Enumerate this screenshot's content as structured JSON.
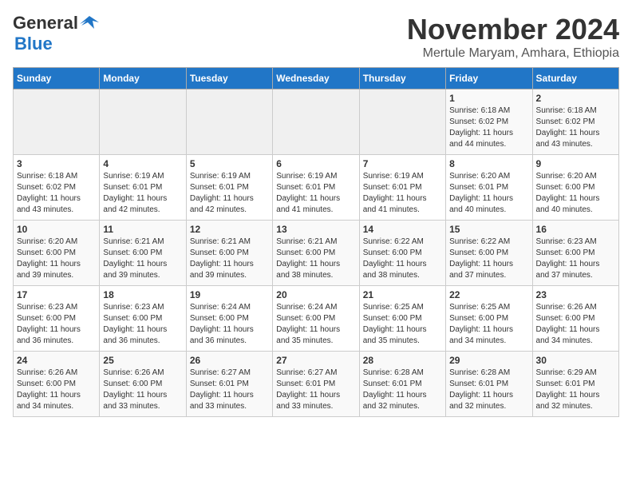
{
  "header": {
    "logo_line1": "General",
    "logo_line2": "Blue",
    "month_title": "November 2024",
    "subtitle": "Mertule Maryam, Amhara, Ethiopia"
  },
  "days_of_week": [
    "Sunday",
    "Monday",
    "Tuesday",
    "Wednesday",
    "Thursday",
    "Friday",
    "Saturday"
  ],
  "weeks": [
    [
      {
        "day": "",
        "info": ""
      },
      {
        "day": "",
        "info": ""
      },
      {
        "day": "",
        "info": ""
      },
      {
        "day": "",
        "info": ""
      },
      {
        "day": "",
        "info": ""
      },
      {
        "day": "1",
        "info": "Sunrise: 6:18 AM\nSunset: 6:02 PM\nDaylight: 11 hours\nand 44 minutes."
      },
      {
        "day": "2",
        "info": "Sunrise: 6:18 AM\nSunset: 6:02 PM\nDaylight: 11 hours\nand 43 minutes."
      }
    ],
    [
      {
        "day": "3",
        "info": "Sunrise: 6:18 AM\nSunset: 6:02 PM\nDaylight: 11 hours\nand 43 minutes."
      },
      {
        "day": "4",
        "info": "Sunrise: 6:19 AM\nSunset: 6:01 PM\nDaylight: 11 hours\nand 42 minutes."
      },
      {
        "day": "5",
        "info": "Sunrise: 6:19 AM\nSunset: 6:01 PM\nDaylight: 11 hours\nand 42 minutes."
      },
      {
        "day": "6",
        "info": "Sunrise: 6:19 AM\nSunset: 6:01 PM\nDaylight: 11 hours\nand 41 minutes."
      },
      {
        "day": "7",
        "info": "Sunrise: 6:19 AM\nSunset: 6:01 PM\nDaylight: 11 hours\nand 41 minutes."
      },
      {
        "day": "8",
        "info": "Sunrise: 6:20 AM\nSunset: 6:01 PM\nDaylight: 11 hours\nand 40 minutes."
      },
      {
        "day": "9",
        "info": "Sunrise: 6:20 AM\nSunset: 6:00 PM\nDaylight: 11 hours\nand 40 minutes."
      }
    ],
    [
      {
        "day": "10",
        "info": "Sunrise: 6:20 AM\nSunset: 6:00 PM\nDaylight: 11 hours\nand 39 minutes."
      },
      {
        "day": "11",
        "info": "Sunrise: 6:21 AM\nSunset: 6:00 PM\nDaylight: 11 hours\nand 39 minutes."
      },
      {
        "day": "12",
        "info": "Sunrise: 6:21 AM\nSunset: 6:00 PM\nDaylight: 11 hours\nand 39 minutes."
      },
      {
        "day": "13",
        "info": "Sunrise: 6:21 AM\nSunset: 6:00 PM\nDaylight: 11 hours\nand 38 minutes."
      },
      {
        "day": "14",
        "info": "Sunrise: 6:22 AM\nSunset: 6:00 PM\nDaylight: 11 hours\nand 38 minutes."
      },
      {
        "day": "15",
        "info": "Sunrise: 6:22 AM\nSunset: 6:00 PM\nDaylight: 11 hours\nand 37 minutes."
      },
      {
        "day": "16",
        "info": "Sunrise: 6:23 AM\nSunset: 6:00 PM\nDaylight: 11 hours\nand 37 minutes."
      }
    ],
    [
      {
        "day": "17",
        "info": "Sunrise: 6:23 AM\nSunset: 6:00 PM\nDaylight: 11 hours\nand 36 minutes."
      },
      {
        "day": "18",
        "info": "Sunrise: 6:23 AM\nSunset: 6:00 PM\nDaylight: 11 hours\nand 36 minutes."
      },
      {
        "day": "19",
        "info": "Sunrise: 6:24 AM\nSunset: 6:00 PM\nDaylight: 11 hours\nand 36 minutes."
      },
      {
        "day": "20",
        "info": "Sunrise: 6:24 AM\nSunset: 6:00 PM\nDaylight: 11 hours\nand 35 minutes."
      },
      {
        "day": "21",
        "info": "Sunrise: 6:25 AM\nSunset: 6:00 PM\nDaylight: 11 hours\nand 35 minutes."
      },
      {
        "day": "22",
        "info": "Sunrise: 6:25 AM\nSunset: 6:00 PM\nDaylight: 11 hours\nand 34 minutes."
      },
      {
        "day": "23",
        "info": "Sunrise: 6:26 AM\nSunset: 6:00 PM\nDaylight: 11 hours\nand 34 minutes."
      }
    ],
    [
      {
        "day": "24",
        "info": "Sunrise: 6:26 AM\nSunset: 6:00 PM\nDaylight: 11 hours\nand 34 minutes."
      },
      {
        "day": "25",
        "info": "Sunrise: 6:26 AM\nSunset: 6:00 PM\nDaylight: 11 hours\nand 33 minutes."
      },
      {
        "day": "26",
        "info": "Sunrise: 6:27 AM\nSunset: 6:01 PM\nDaylight: 11 hours\nand 33 minutes."
      },
      {
        "day": "27",
        "info": "Sunrise: 6:27 AM\nSunset: 6:01 PM\nDaylight: 11 hours\nand 33 minutes."
      },
      {
        "day": "28",
        "info": "Sunrise: 6:28 AM\nSunset: 6:01 PM\nDaylight: 11 hours\nand 32 minutes."
      },
      {
        "day": "29",
        "info": "Sunrise: 6:28 AM\nSunset: 6:01 PM\nDaylight: 11 hours\nand 32 minutes."
      },
      {
        "day": "30",
        "info": "Sunrise: 6:29 AM\nSunset: 6:01 PM\nDaylight: 11 hours\nand 32 minutes."
      }
    ]
  ]
}
